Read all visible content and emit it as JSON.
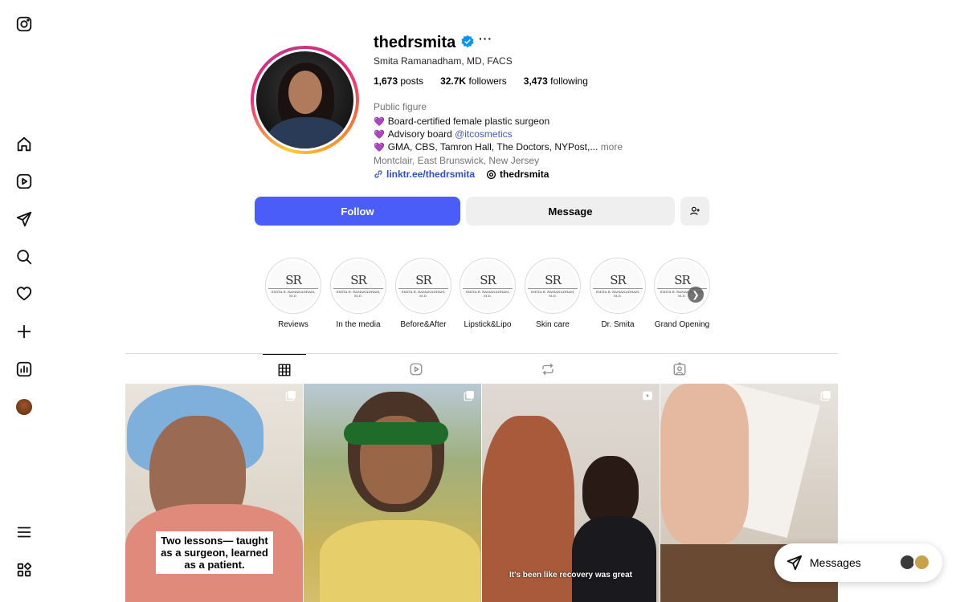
{
  "nav": {
    "icons": [
      "instagram-logo-icon",
      "home-icon",
      "reels-icon",
      "direct-icon",
      "search-icon",
      "heart-icon",
      "create-icon",
      "insights-icon",
      "profile-avatar-icon",
      "menu-icon",
      "more-apps-icon"
    ]
  },
  "profile": {
    "username": "thedrsmita",
    "more": "···",
    "full_name": "Smita Ramanadham, MD, FACS",
    "stats": {
      "posts_count": "1,673",
      "posts_label": "posts",
      "followers_count": "32.7K",
      "followers_label": "followers",
      "following_count": "3,473",
      "following_label": "following"
    },
    "category": "Public figure",
    "bio": {
      "line1": "Board-certified female plastic surgeon",
      "line2_prefix": "Advisory board ",
      "line2_mention": "@itcosmetics",
      "line3": "GMA, CBS, Tamron Hall, The Doctors, NYPost,...",
      "more": "more",
      "heart": "💜"
    },
    "location": "Montclair, East Brunswick, New Jersey",
    "link": "linktr.ee/thedrsmita",
    "threads": "thedrsmita"
  },
  "actions": {
    "follow": "Follow",
    "message": "Message"
  },
  "highlights": [
    {
      "label": "Reviews",
      "logo": "SR",
      "caption": "SMITA R. RAMANADHAM, M.D."
    },
    {
      "label": "In the media",
      "logo": "SR",
      "caption": "SMITA R. RAMANADHAM, M.D."
    },
    {
      "label": "Before&After",
      "logo": "SR",
      "caption": "SMITA R. RAMANADHAM, M.D."
    },
    {
      "label": "Lipstick&Lipo",
      "logo": "SR",
      "caption": "SMITA R. RAMANADHAM, M.D."
    },
    {
      "label": "Skin care",
      "logo": "SR",
      "caption": "SMITA R. RAMANADHAM, M.D."
    },
    {
      "label": "Dr. Smita",
      "logo": "SR",
      "caption": "SMITA R. RAMANADHAM, M.D."
    },
    {
      "label": "Grand Opening",
      "logo": "SR",
      "caption": "SMITA R. RAMANADHAM, M.D."
    }
  ],
  "posts": {
    "p1_caption": "Two lessons— taught as a surgeon, learned as a patient.",
    "p3_caption": "It's been like recovery was great"
  },
  "messages": {
    "label": "Messages"
  },
  "colors": {
    "follow_blue": "#4a5df9",
    "link_blue": "#2f4fb8",
    "verified_blue": "#0095f6"
  }
}
